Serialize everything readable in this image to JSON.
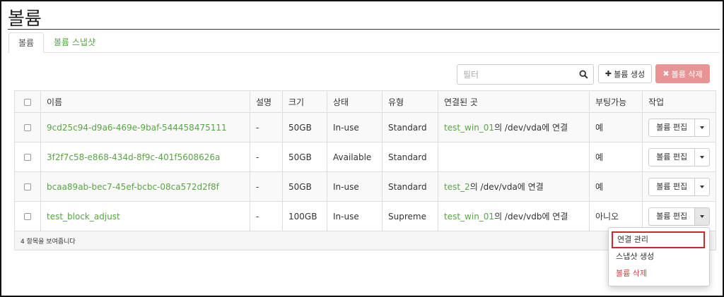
{
  "page": {
    "title": "볼륨"
  },
  "tabs": [
    {
      "label": "볼륨"
    },
    {
      "label": "볼륨 스냅샷"
    }
  ],
  "toolbar": {
    "filter_placeholder": "필터",
    "create_label": "볼륨 생성",
    "delete_label": "볼륨 삭제"
  },
  "table": {
    "headers": {
      "name": "이름",
      "description": "설명",
      "size": "크기",
      "status": "상태",
      "type": "유형",
      "attached_to": "연결된 곳",
      "bootable": "부팅가능",
      "actions": "작업"
    },
    "rows": [
      {
        "name": "9cd25c94-d9a6-469e-9baf-544458475111",
        "description": "-",
        "size": "50GB",
        "status": "In-use",
        "type": "Standard",
        "attach_link": "test_win_01",
        "attach_rest": "의 /dev/vda에 연결",
        "bootable": "예",
        "edit_label": "볼륨 편집"
      },
      {
        "name": "3f2f7c58-e868-434d-8f9c-401f5608626a",
        "description": "-",
        "size": "50GB",
        "status": "Available",
        "type": "Standard",
        "attach_link": "",
        "attach_rest": "",
        "bootable": "예",
        "edit_label": "볼륨 편집"
      },
      {
        "name": "bcaa89ab-bec7-45ef-bcbc-08ca572d2f8f",
        "description": "-",
        "size": "50GB",
        "status": "In-use",
        "type": "Standard",
        "attach_link": "test_2",
        "attach_rest": "의 /dev/vda에 연결",
        "bootable": "예",
        "edit_label": "볼륨 편집"
      },
      {
        "name": "test_block_adjust",
        "description": "-",
        "size": "100GB",
        "status": "In-use",
        "type": "Supreme",
        "attach_link": "test_win_01",
        "attach_rest": "의 /dev/vdb에 연결",
        "bootable": "아니오",
        "edit_label": "볼륨 편집"
      }
    ],
    "footer": "4 항목을 보여줍니다"
  },
  "dropdown": {
    "items": [
      {
        "label": "연결 관리"
      },
      {
        "label": "스냅샷 생성"
      },
      {
        "label": "볼륨 삭제"
      }
    ]
  },
  "colors": {
    "link": "#58a545",
    "danger_button": "#e99494",
    "highlight_border": "#d0262f"
  }
}
